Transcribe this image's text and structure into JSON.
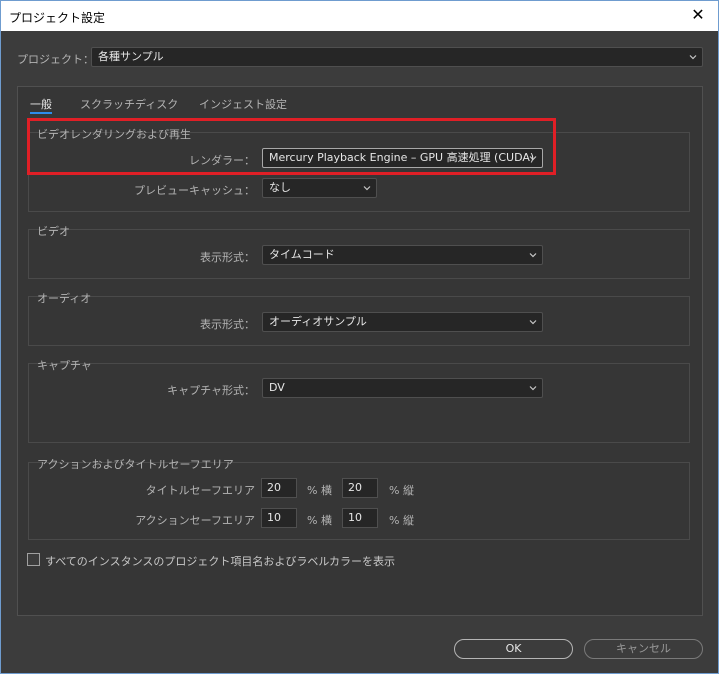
{
  "window": {
    "title": "プロジェクト設定",
    "close_glyph": "✕"
  },
  "project": {
    "label": "プロジェクト：",
    "value": "各種サンプル"
  },
  "tabs": [
    {
      "label": "一般",
      "active": true
    },
    {
      "label": "スクラッチディスク",
      "active": false
    },
    {
      "label": "インジェスト設定",
      "active": false
    }
  ],
  "video_rendering": {
    "title": "ビデオレンダリングおよび再生",
    "renderer_label": "レンダラー：",
    "renderer_value": "Mercury Playback Engine – GPU 高速処理 (CUDA)",
    "preview_cache_label": "プレビューキャッシュ：",
    "preview_cache_value": "なし"
  },
  "video": {
    "title": "ビデオ",
    "display_format_label": "表示形式：",
    "display_format_value": "タイムコード"
  },
  "audio": {
    "title": "オーディオ",
    "display_format_label": "表示形式：",
    "display_format_value": "オーディオサンプル"
  },
  "capture": {
    "title": "キャプチャ",
    "format_label": "キャプチャ形式：",
    "format_value": "DV"
  },
  "safe_area": {
    "title": "アクションおよびタイトルセーフエリア",
    "title_safe_label": "タイトルセーフエリア",
    "title_safe_h": "20",
    "title_safe_v": "20",
    "action_safe_label": "アクションセーフエリア",
    "action_safe_h": "10",
    "action_safe_v": "10",
    "pct_h": "% 横",
    "pct_v": "% 縦"
  },
  "show_label_colors": {
    "label": "すべてのインスタンスのプロジェクト項目名およびラベルカラーを表示",
    "checked": false
  },
  "buttons": {
    "ok": "OK",
    "cancel": "キャンセル"
  },
  "colors": {
    "tab_accent": "#2d8ceb",
    "highlight_box": "#e01f26"
  }
}
